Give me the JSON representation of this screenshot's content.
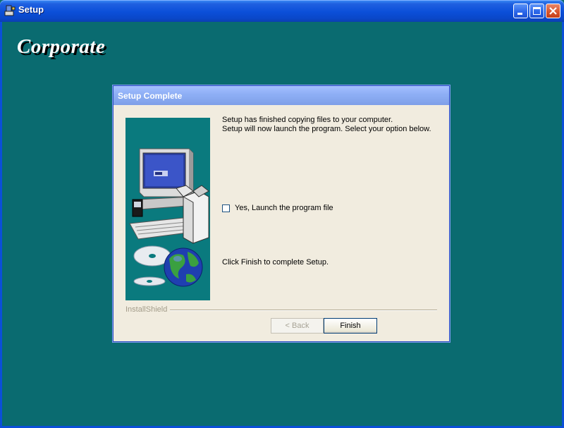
{
  "window": {
    "title": "Setup",
    "background_color": "#0a6b70",
    "controls": [
      "minimize-icon",
      "maximize-icon",
      "close-icon"
    ]
  },
  "brand": {
    "text": "Corporate"
  },
  "dialog": {
    "title": "Setup Complete",
    "message_line1": "Setup has finished copying files to your computer.",
    "message_line2": "Setup will now launch the program. Select your option below.",
    "checkbox": {
      "label": "Yes, Launch the program file",
      "checked": false
    },
    "finish_instruction": "Click Finish to complete Setup.",
    "group_label": "InstallShield",
    "buttons": {
      "back": "< Back",
      "finish": "Finish"
    }
  }
}
